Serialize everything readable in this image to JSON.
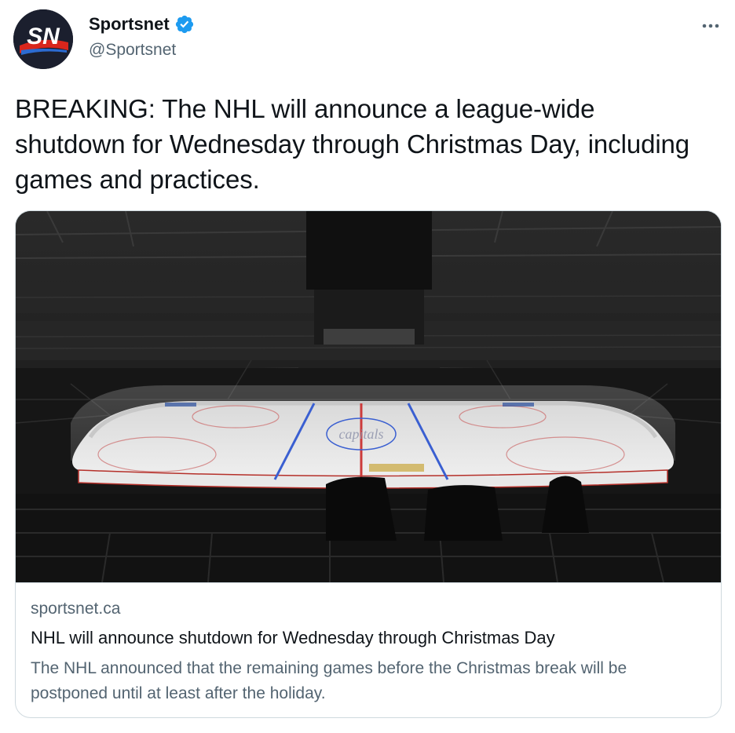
{
  "author": {
    "display_name": "Sportsnet",
    "handle": "@Sportsnet",
    "avatar_text": "SN",
    "verified": true
  },
  "tweet": {
    "text": "BREAKING: The NHL will announce a league-wide shutdown for Wednesday through Christmas Day, including games and practices."
  },
  "card": {
    "domain": "sportsnet.ca",
    "title": "NHL will announce shutdown for Wednesday through Christmas Day",
    "description": "The NHL announced that the remaining games before the Christmas break will be postponed until at least after the holiday.",
    "image_subject": "empty-hockey-arena",
    "rink_logo_text": "capitals"
  },
  "icons": {
    "more": "more-horizontal-icon",
    "verified": "verified-badge-icon"
  },
  "colors": {
    "verified_blue": "#1d9bf0",
    "text_primary": "#0f1419",
    "text_secondary": "#536471",
    "border": "#cfd9de",
    "avatar_bg": "#1b1f2e",
    "avatar_red": "#d9261c"
  }
}
